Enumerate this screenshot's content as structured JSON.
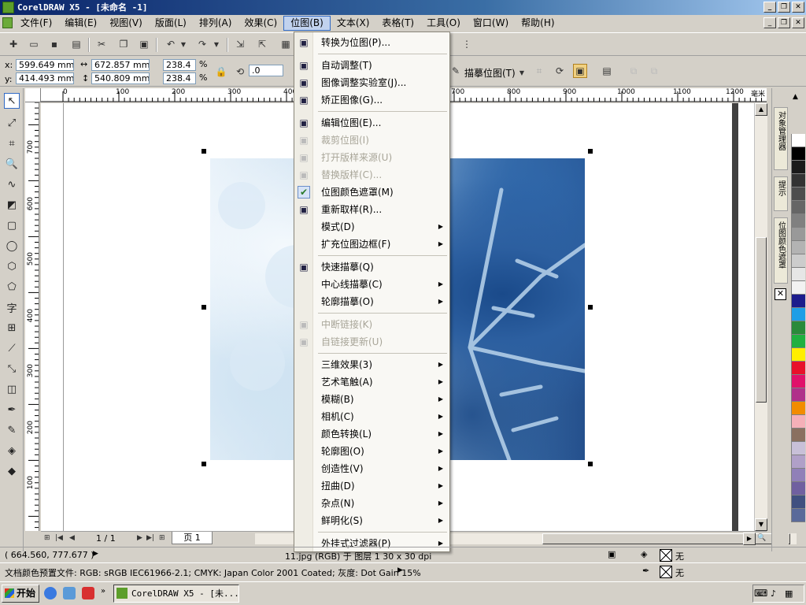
{
  "window": {
    "title": "CorelDRAW X5 - [未命名 -1]",
    "controls": {
      "minimize": "_",
      "restore": "❐",
      "close": "✕"
    }
  },
  "menubar": {
    "items": [
      "文件(F)",
      "编辑(E)",
      "视图(V)",
      "版面(L)",
      "排列(A)",
      "效果(C)",
      "位图(B)",
      "文本(X)",
      "表格(T)",
      "工具(O)",
      "窗口(W)",
      "帮助(H)"
    ],
    "active_index": 6
  },
  "toolbar": {
    "trace_bitmap_label": "描摹位图(T)"
  },
  "propbar": {
    "x_label": "x:",
    "x_value": "599.649 mm",
    "y_label": "y:",
    "y_value": "414.493 mm",
    "width_value": "672.857 mm",
    "height_value": "540.809 mm",
    "scale_x": "238.4",
    "scale_y": "238.4",
    "percent": "%",
    "angle_value": ".0"
  },
  "ruler": {
    "h_labels": [
      "0",
      "100",
      "200",
      "300",
      "400",
      "700",
      "800",
      "900",
      "1000",
      "1100",
      "1200"
    ],
    "h_unit": "毫米",
    "v_labels": [
      "700",
      "600",
      "500",
      "400",
      "300",
      "200",
      "100"
    ]
  },
  "bitmap_menu": {
    "items": [
      {
        "label": "转换为位图(P)...",
        "icon": "convert-bitmap-icon",
        "enabled": true
      },
      {
        "sep": true
      },
      {
        "label": "自动调整(T)",
        "icon": "auto-adjust-icon",
        "enabled": true
      },
      {
        "label": "图像调整实验室(J)...",
        "icon": "image-lab-icon",
        "enabled": true
      },
      {
        "label": "矫正图像(G)...",
        "icon": "straighten-icon",
        "enabled": true
      },
      {
        "sep": true
      },
      {
        "label": "编辑位图(E)...",
        "icon": "edit-bitmap-icon",
        "enabled": true
      },
      {
        "label": "裁剪位图(I)",
        "icon": "crop-bitmap-icon",
        "enabled": false
      },
      {
        "label": "打开版样来源(U)",
        "icon": "open-source-icon",
        "enabled": false
      },
      {
        "label": "替换版样(C)...",
        "icon": "replace-icon",
        "enabled": false
      },
      {
        "label": "位图颜色遮罩(M)",
        "icon": "checkmark-icon",
        "enabled": true,
        "checked": true
      },
      {
        "label": "重新取样(R)...",
        "icon": "resample-icon",
        "enabled": true
      },
      {
        "label": "模式(D)",
        "submenu": true,
        "enabled": true
      },
      {
        "label": "扩充位图边框(F)",
        "submenu": true,
        "enabled": true
      },
      {
        "sep": true
      },
      {
        "label": "快速描摹(Q)",
        "icon": "quick-trace-icon",
        "enabled": true
      },
      {
        "label": "中心线描摹(C)",
        "submenu": true,
        "enabled": true
      },
      {
        "label": "轮廓描摹(O)",
        "submenu": true,
        "enabled": true
      },
      {
        "sep": true
      },
      {
        "label": "中断链接(K)",
        "icon": "break-link-icon",
        "enabled": false
      },
      {
        "label": "自链接更新(U)",
        "icon": "update-link-icon",
        "enabled": false
      },
      {
        "sep": true
      },
      {
        "label": "三维效果(3)",
        "submenu": true,
        "enabled": true
      },
      {
        "label": "艺术笔触(A)",
        "submenu": true,
        "enabled": true
      },
      {
        "label": "模糊(B)",
        "submenu": true,
        "enabled": true
      },
      {
        "label": "相机(C)",
        "submenu": true,
        "enabled": true
      },
      {
        "label": "颜色转换(L)",
        "submenu": true,
        "enabled": true
      },
      {
        "label": "轮廓图(O)",
        "submenu": true,
        "enabled": true
      },
      {
        "label": "创造性(V)",
        "submenu": true,
        "enabled": true
      },
      {
        "label": "扭曲(D)",
        "submenu": true,
        "enabled": true
      },
      {
        "label": "杂点(N)",
        "submenu": true,
        "enabled": true
      },
      {
        "label": "鲜明化(S)",
        "submenu": true,
        "enabled": true
      },
      {
        "sep": true
      },
      {
        "label": "外挂式过滤器(P)",
        "submenu": true,
        "enabled": true
      }
    ]
  },
  "page_nav": {
    "count": "1 / 1",
    "tab": "页 1"
  },
  "dockers": {
    "tabs": [
      "对象管理器",
      "提示",
      "位图颜色遮罩"
    ]
  },
  "palette": [
    "#ffffff",
    "#000000",
    "#1a1a1a",
    "#333333",
    "#4d4d4d",
    "#666666",
    "#808080",
    "#999999",
    "#b3b3b3",
    "#cccccc",
    "#e6e6e6",
    "#f2f2f2",
    "#1c1c8c",
    "#1e9ee6",
    "#2a8a3a",
    "#20b040",
    "#ffee00",
    "#e8102a",
    "#e0106a",
    "#b0308a",
    "#f28c00",
    "#f5b0b8",
    "#8a7060",
    "#c8c0d8",
    "#b0a0c8",
    "#9080b8",
    "#7060a0",
    "#405080",
    "#5a6a9a"
  ],
  "status": {
    "coords": "( 664.560, 777.677 )",
    "object_info": "11.jpg (RGB) 于 图层 1 30 x 30 dpi",
    "fill_label": "无",
    "outline_label": "无",
    "color_profile": "文档颜色预置文件: RGB: sRGB IEC61966-2.1; CMYK: Japan Color 2001 Coated; 灰度: Dot Gain 15%"
  },
  "taskbar": {
    "start": "开始",
    "task": "CorelDRAW X5 - [未...",
    "tray": "«"
  }
}
